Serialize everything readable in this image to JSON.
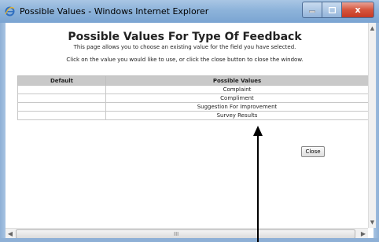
{
  "window": {
    "title": "Possible Values - Windows Internet Explorer",
    "close_glyph": "x"
  },
  "page": {
    "heading": "Possible Values For Type Of Feedback",
    "subtext": "This page allows you to choose an existing value for the field you have selected.",
    "instruction": "Click on the value you would like to use, or click the close button to close the window."
  },
  "table": {
    "headers": [
      "Default",
      "Possible Values"
    ],
    "rows": [
      {
        "default": "",
        "value": "Complaint"
      },
      {
        "default": "",
        "value": "Compliment"
      },
      {
        "default": "",
        "value": "Suggestion For Improvement"
      },
      {
        "default": "",
        "value": "Survey Results"
      }
    ]
  },
  "buttons": {
    "close_label": "Close"
  },
  "scrollbar": {
    "grip": "III"
  },
  "colors": {
    "titlebar": "#8db3da",
    "close_button": "#d6553d",
    "table_header": "#c9c9c9"
  }
}
